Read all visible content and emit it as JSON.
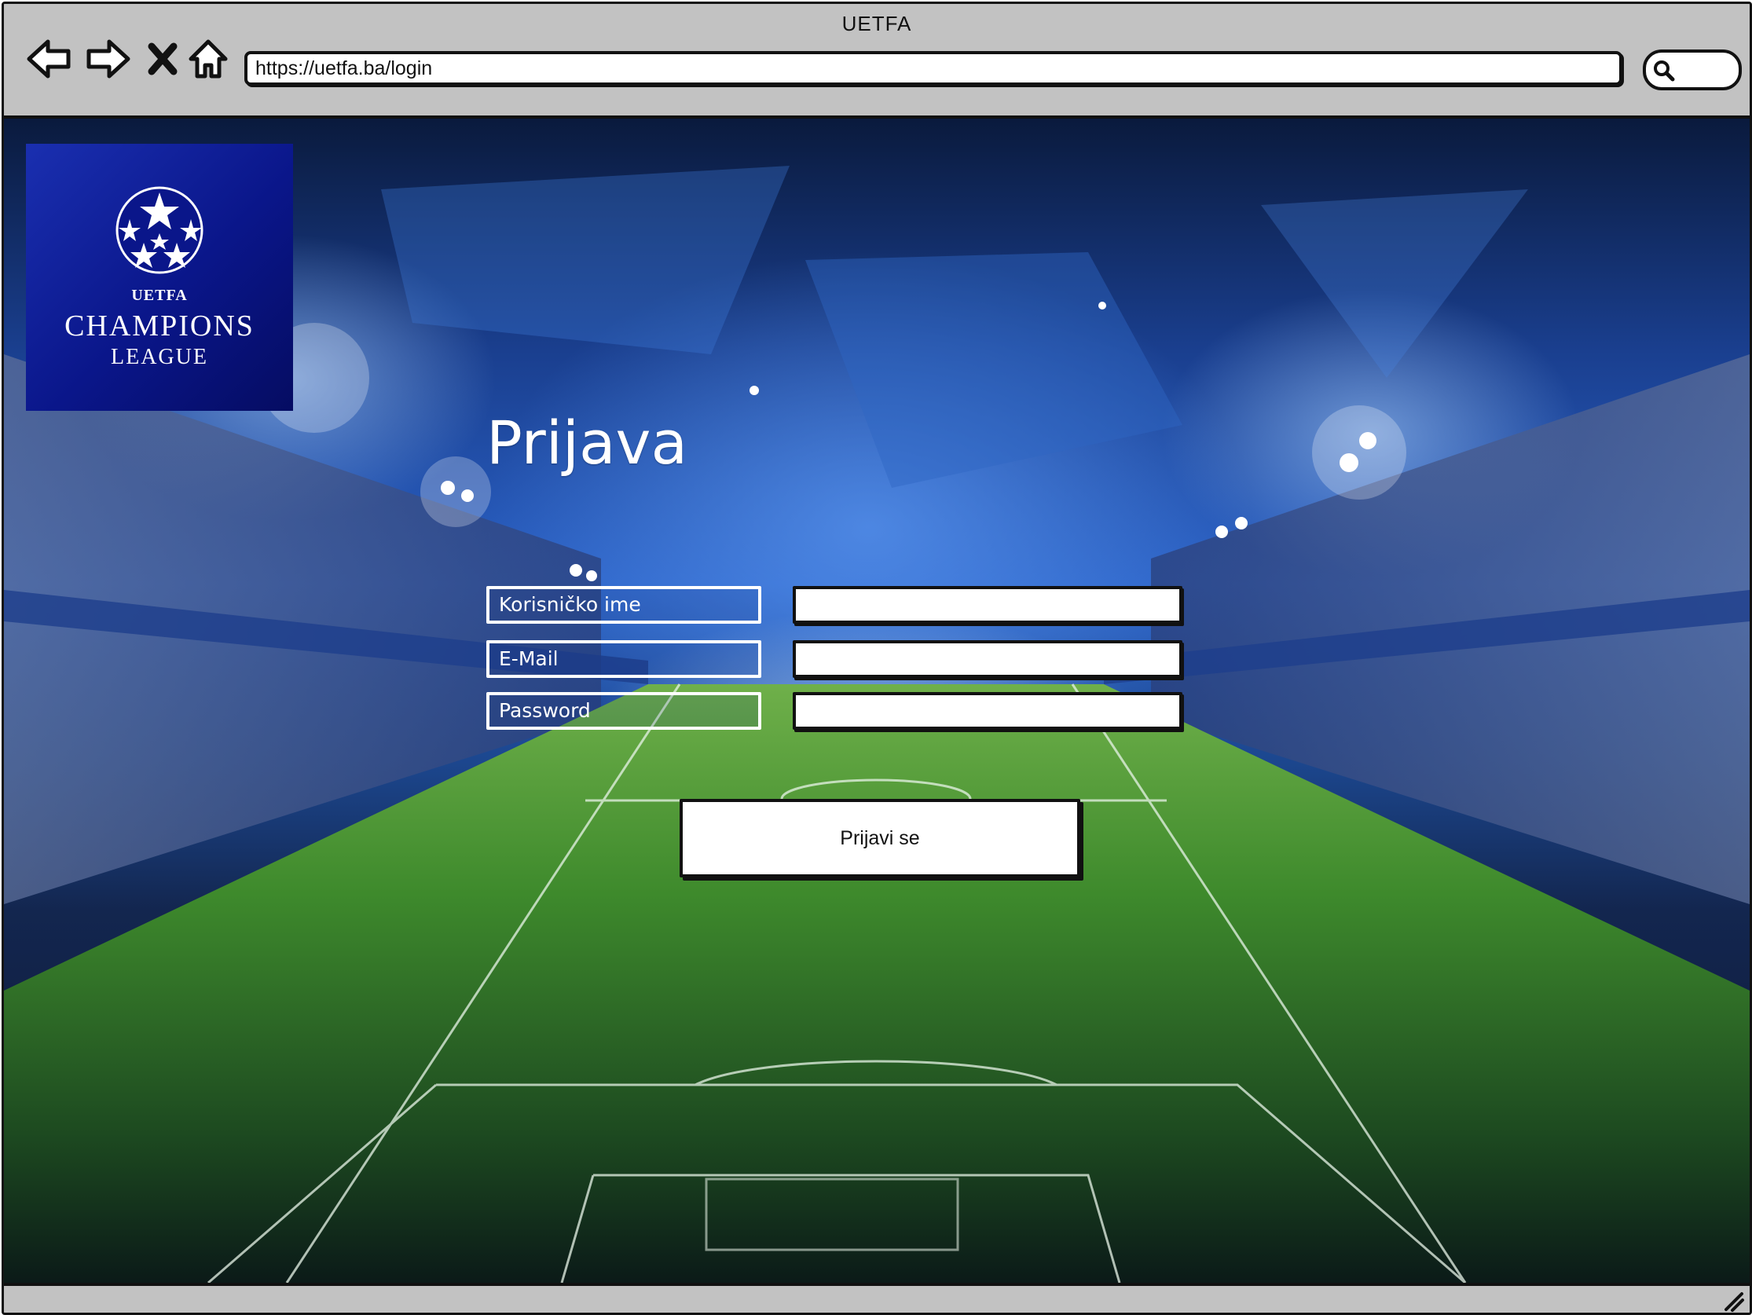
{
  "browser": {
    "title": "UETFA",
    "url": "https://uetfa.ba/login",
    "nav_icons": [
      "back-arrow-icon",
      "forward-arrow-icon",
      "close-icon",
      "home-icon"
    ],
    "search_icon": "search-icon"
  },
  "logo": {
    "small_text": "UETFA",
    "main_text": "CHAMPIONS",
    "sub_text": "LEAGUE"
  },
  "login": {
    "heading": "Prijava",
    "fields": [
      {
        "label": "Korisničko ime",
        "value": ""
      },
      {
        "label": "E-Mail",
        "value": ""
      },
      {
        "label": "Password",
        "value": ""
      }
    ],
    "submit_label": "Prijavi se"
  },
  "colors": {
    "window_chrome": "#c2c2c2",
    "logo_bg": "#0a168a",
    "field_border": "#ffffff"
  }
}
